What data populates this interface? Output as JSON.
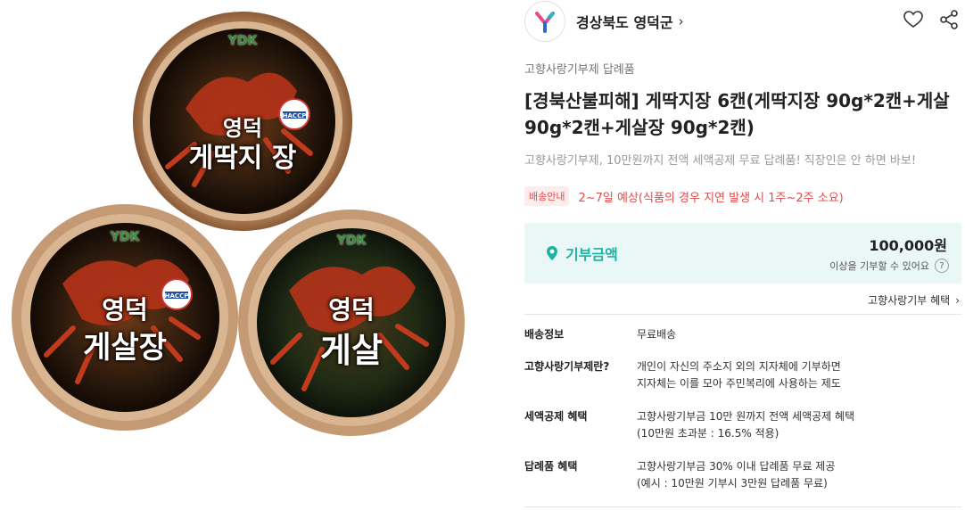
{
  "seller": {
    "name": "경상북도 영덕군",
    "chevron": "›"
  },
  "product": {
    "category": "고향사랑기부제 답례품",
    "title": "[경북산불피해] 게딱지장 6캔(게딱지장 90g*2캔+게살 90g*2캔+게살장 90g*2캔)",
    "subtitle": "고향사랑기부제, 10만원까지 전액 세액공제 무료 답례품! 직장인은 안 하면 바보!",
    "shipping_badge": "배송안내",
    "shipping_text": "2~7일 예상(식품의 경우 지연 발생 시 1주~2주 소요)"
  },
  "image_labels": {
    "brand": "YDK",
    "tin1_line1": "영덕",
    "tin1_line2": "게딱지 장",
    "tin2_line1": "영덕",
    "tin2_line2": "게살장",
    "tin3_line1": "영덕",
    "tin3_line2": "게살",
    "haccp": "HACCP"
  },
  "donation": {
    "label": "기부금액",
    "amount": "100,000원",
    "note": "이상을 기부할 수 있어요",
    "help": "?"
  },
  "benefit_link": {
    "label": "고향사랑기부 혜택",
    "chevron": "›"
  },
  "info": [
    {
      "key": "배송정보",
      "lines": [
        "무료배송"
      ]
    },
    {
      "key": "고향사랑기부제란?",
      "lines": [
        "개인이 자신의 주소지 외의 지자체에 기부하면",
        "지자체는 이를 모아 주민복리에 사용하는 제도"
      ]
    },
    {
      "key": "세액공제 혜택",
      "lines": [
        "고향사랑기부금 10만 원까지 전액 세액공제 혜택",
        "(10만원 초과분 : 16.5% 적용)"
      ]
    },
    {
      "key": "답례품 혜택",
      "lines": [
        "고향사랑기부금 30% 이내 답례품 무료 제공",
        "(예시 : 10만원 기부시 3만원 답례품 무료)"
      ]
    }
  ],
  "colors": {
    "accent": "#1db3a3",
    "shipping": "#e24b4b",
    "donation_bg": "#e9f7f6"
  },
  "icons": {
    "logo": "yeongdeok-logo-icon",
    "heart": "heart-icon",
    "share": "share-icon",
    "pin": "location-pin-icon"
  }
}
